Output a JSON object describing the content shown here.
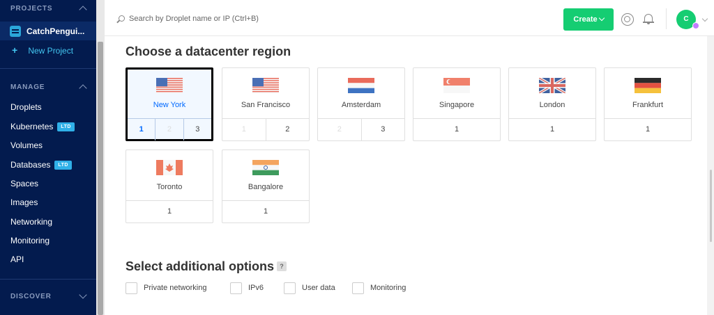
{
  "sidebar": {
    "projects_heading": "PROJECTS",
    "current_project": "CatchPengui...",
    "new_project": "New Project",
    "manage_heading": "MANAGE",
    "items": [
      {
        "label": "Droplets",
        "badge": ""
      },
      {
        "label": "Kubernetes",
        "badge": "LTD"
      },
      {
        "label": "Volumes",
        "badge": ""
      },
      {
        "label": "Databases",
        "badge": "LTD"
      },
      {
        "label": "Spaces",
        "badge": ""
      },
      {
        "label": "Images",
        "badge": ""
      },
      {
        "label": "Networking",
        "badge": ""
      },
      {
        "label": "Monitoring",
        "badge": ""
      },
      {
        "label": "API",
        "badge": ""
      }
    ],
    "discover_heading": "DISCOVER"
  },
  "header": {
    "search_placeholder": "Search by Droplet name or IP (Ctrl+B)",
    "create_label": "Create",
    "avatar_initial": "C"
  },
  "datacenter": {
    "title": "Choose a datacenter region",
    "regions": [
      {
        "name": "New York",
        "flag": "us-flag",
        "selected": true,
        "datacenters": [
          {
            "label": "1",
            "state": "active"
          },
          {
            "label": "2",
            "state": "disabled"
          },
          {
            "label": "3",
            "state": "normal"
          }
        ]
      },
      {
        "name": "San Francisco",
        "flag": "us-flag",
        "selected": false,
        "datacenters": [
          {
            "label": "1",
            "state": "disabled"
          },
          {
            "label": "2",
            "state": "normal"
          }
        ]
      },
      {
        "name": "Amsterdam",
        "flag": "nl-flag",
        "selected": false,
        "datacenters": [
          {
            "label": "2",
            "state": "disabled"
          },
          {
            "label": "3",
            "state": "normal"
          }
        ]
      },
      {
        "name": "Singapore",
        "flag": "sg-flag",
        "selected": false,
        "datacenters": [
          {
            "label": "1",
            "state": "normal"
          }
        ]
      },
      {
        "name": "London",
        "flag": "uk-flag",
        "selected": false,
        "datacenters": [
          {
            "label": "1",
            "state": "normal"
          }
        ]
      },
      {
        "name": "Frankfurt",
        "flag": "de-flag",
        "selected": false,
        "datacenters": [
          {
            "label": "1",
            "state": "normal"
          }
        ]
      },
      {
        "name": "Toronto",
        "flag": "ca-flag",
        "selected": false,
        "datacenters": [
          {
            "label": "1",
            "state": "normal"
          }
        ]
      },
      {
        "name": "Bangalore",
        "flag": "in-flag",
        "selected": false,
        "datacenters": [
          {
            "label": "1",
            "state": "normal"
          }
        ]
      }
    ]
  },
  "options": {
    "title": "Select additional options",
    "help": "?",
    "items": [
      {
        "label": "Private networking",
        "checked": false
      },
      {
        "label": "IPv6",
        "checked": false
      },
      {
        "label": "User data",
        "checked": false
      },
      {
        "label": "Monitoring",
        "checked": false
      }
    ]
  },
  "colors": {
    "sidebar_bg": "#031b4e",
    "accent_blue": "#0069ff",
    "create_green": "#15cd72",
    "link_cyan": "#43c6f0"
  }
}
